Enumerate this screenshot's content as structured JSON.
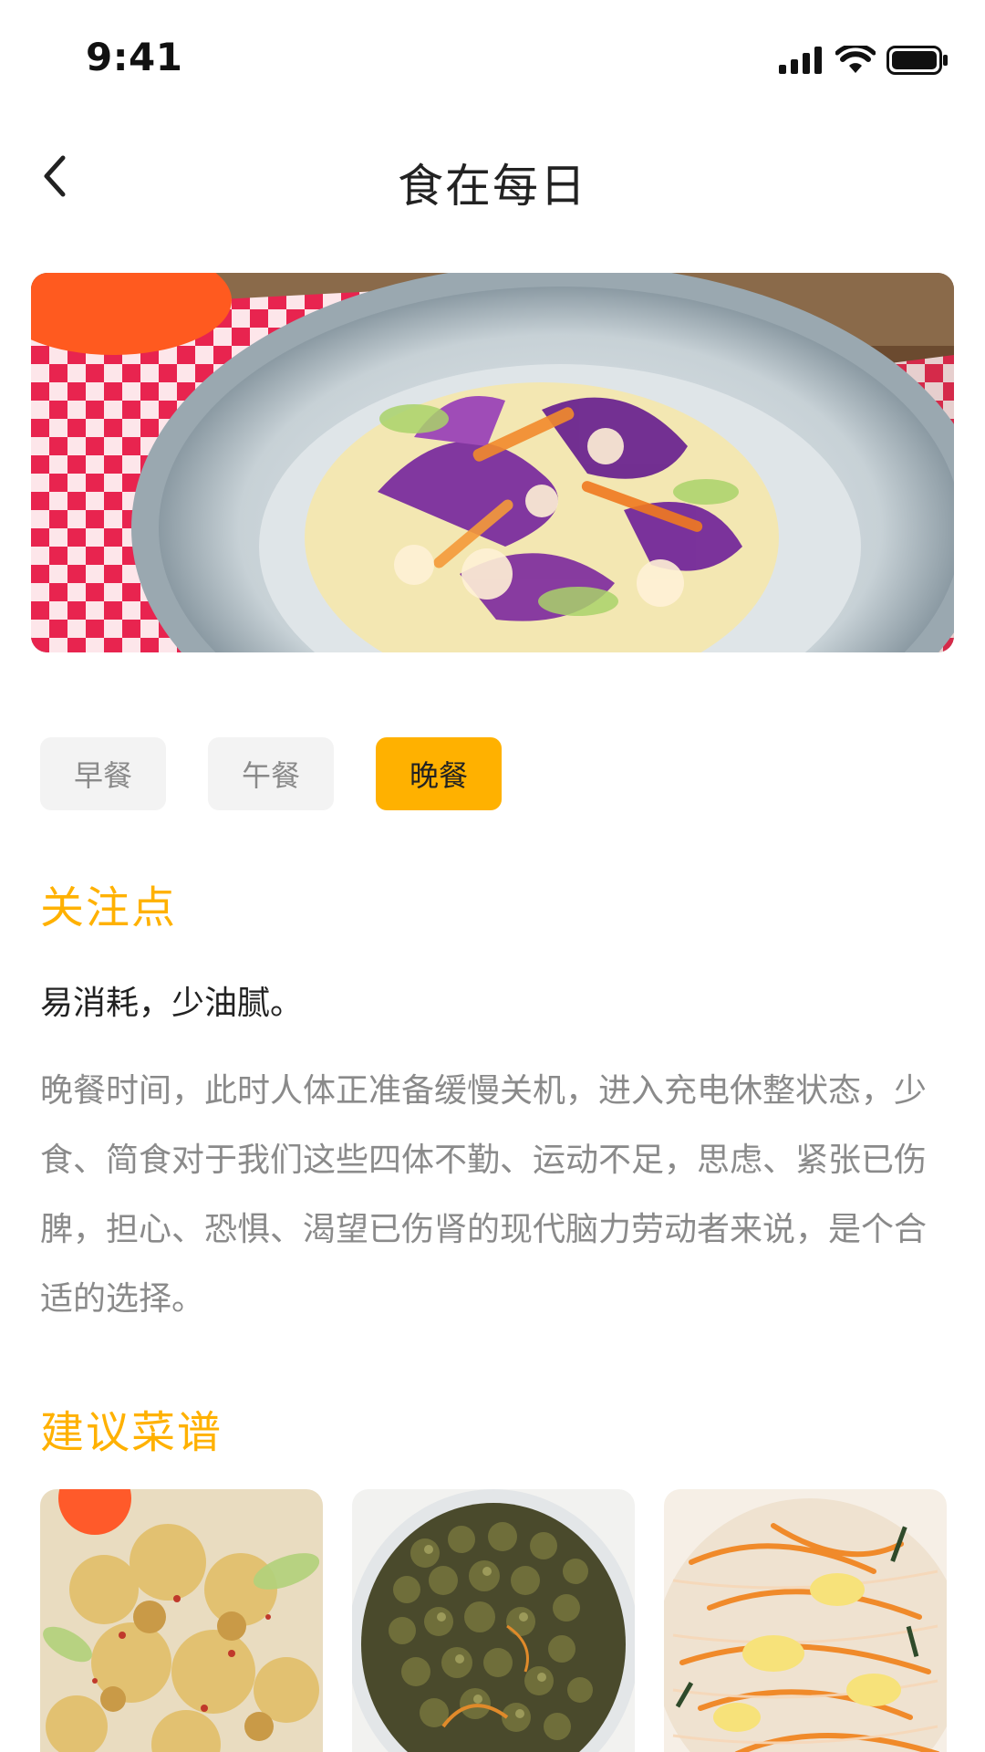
{
  "status_bar": {
    "time": "9:41",
    "icons": [
      "cellular-signal-icon",
      "wifi-icon",
      "battery-icon"
    ]
  },
  "header": {
    "title": "食在每日",
    "back_icon": "chevron-left-icon"
  },
  "hero_image": {
    "description_icon": "salad-photo"
  },
  "meal_tabs": [
    {
      "label": "早餐",
      "active": false
    },
    {
      "label": "午餐",
      "active": false
    },
    {
      "label": "晚餐",
      "active": true
    }
  ],
  "focus": {
    "heading": "关注点",
    "summary": "易消耗，少油腻。",
    "body": "晚餐时间，此时人体正准备缓慢关机，进入充电休整状态，少食、简食对于我们这些四体不勤、运动不足，思虑、紧张已伤脾，担心、恐惧、渴望已伤肾的现代脑力劳动者来说，是个合适的选择。"
  },
  "recipes": {
    "heading": "建议菜谱"
  },
  "colors": {
    "accent": "#ffb100",
    "tab_inactive_bg": "#f3f3f3",
    "text_muted": "#8a8a8a",
    "text_primary": "#222222"
  }
}
